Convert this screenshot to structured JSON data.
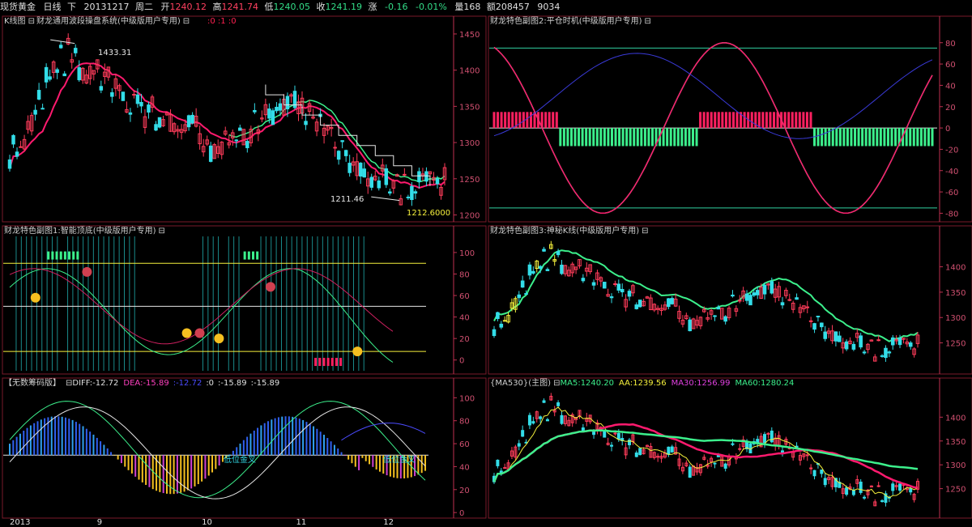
{
  "header": {
    "symbol": "现货黄金",
    "period": "日线",
    "dir": "下",
    "date": "20131217",
    "weekday": "周二",
    "open_label": "开",
    "open": "1240.12",
    "high_label": "高",
    "high": "1241.74",
    "low_label": "低",
    "low": "1240.05",
    "close_label": "收",
    "close": "1241.19",
    "chg_label": "涨",
    "chg": "-0.16",
    "pct": "-0.01%",
    "vol_label": "量",
    "vol": "168",
    "amt_label": "额",
    "amt": "208457",
    "last": "9034"
  },
  "colors": {
    "up": "#ff3c5a",
    "down": "#33dde8",
    "frame": "#7a1a2a",
    "axis": "#c03050",
    "green": "#3cf08c",
    "pink": "#ff1a6e",
    "white": "#e6e6e6",
    "yellow": "#f5f03c",
    "blue": "#3a3ad8",
    "purple": "#d040d0"
  },
  "panels": {
    "kline": {
      "title": "K线图",
      "subtitle": "财龙通用波段操盘系统(中级版用户专用)",
      "params": ":0  :1  :0",
      "high_mark": "1433.31",
      "low_mark": "1211.46",
      "stop_mark": "1212.6000"
    },
    "smart": {
      "title": "财龙特色副图1:智能顶底(中级版用户专用)"
    },
    "chip": {
      "title": "【无数筹码版】",
      "diff_label": "DIFF:",
      "diff": "-12.72",
      "dea_label": "DEA:",
      "dea": "-15.89",
      "v1": ":-12.72",
      "v2": ":0",
      "v3": ":-15.89",
      "v4": ":-15.89",
      "ann1": "低位金叉",
      "ann2": "低位金叉"
    },
    "timing": {
      "title": "财龙特色副图2:平仓时机(中级版用户专用)"
    },
    "mystic": {
      "title": "财龙特色副图3:神秘K线(中级版用户专用)"
    },
    "ma": {
      "title": "{MA530}(主图)",
      "ma5_label": "MA5:",
      "ma5": "1240.20",
      "aa_label": "AA:",
      "aa": "1239.56",
      "ma30_label": "MA30:",
      "ma30": "1256.99",
      "ma60_label": "MA60:",
      "ma60": "1280.24"
    }
  },
  "xaxis": {
    "labels": [
      "2013",
      "9",
      "10",
      "11",
      "12"
    ],
    "positions": [
      0,
      25,
      55,
      82,
      107
    ]
  },
  "chart_data": [
    {
      "type": "candlestick",
      "name": "kline",
      "yticks": [
        1200,
        1250,
        1300,
        1350,
        1400,
        1450
      ],
      "ylim": [
        1195,
        1460
      ],
      "trend": [
        [
          0,
          1280
        ],
        [
          5,
          1320
        ],
        [
          10,
          1380
        ],
        [
          16,
          1425
        ],
        [
          20,
          1405
        ],
        [
          25,
          1395
        ],
        [
          30,
          1370
        ],
        [
          35,
          1345
        ],
        [
          40,
          1335
        ],
        [
          45,
          1325
        ],
        [
          50,
          1320
        ],
        [
          55,
          1295
        ],
        [
          60,
          1305
        ],
        [
          65,
          1315
        ],
        [
          70,
          1340
        ],
        [
          75,
          1355
        ],
        [
          80,
          1345
        ],
        [
          85,
          1325
        ],
        [
          90,
          1300
        ],
        [
          95,
          1275
        ],
        [
          100,
          1250
        ],
        [
          105,
          1235
        ],
        [
          110,
          1230
        ],
        [
          112,
          1255
        ],
        [
          115,
          1240
        ],
        [
          119,
          1240
        ]
      ]
    },
    {
      "type": "line",
      "name": "smart",
      "yticks": [
        0,
        20,
        40,
        60,
        80,
        100
      ],
      "ylim": [
        -10,
        115
      ],
      "hlines": [
        90,
        50,
        8
      ]
    },
    {
      "type": "bar",
      "name": "chip",
      "yticks": [
        0,
        20,
        40,
        60,
        80,
        100
      ],
      "ylim": [
        -2,
        108
      ]
    },
    {
      "type": "line",
      "name": "timing",
      "yticks": [
        -80,
        -60,
        -40,
        -20,
        0,
        20,
        40,
        60,
        80
      ],
      "ylim": [
        -85,
        95
      ],
      "hlines": [
        75,
        -75
      ]
    },
    {
      "type": "candlestick",
      "name": "mystic",
      "yticks": [
        1250,
        1300,
        1350,
        1400
      ],
      "ylim": [
        1195,
        1460
      ]
    },
    {
      "type": "line",
      "name": "ma",
      "yticks": [
        1250,
        1300,
        1350,
        1400
      ],
      "ylim": [
        1195,
        1460
      ]
    }
  ]
}
